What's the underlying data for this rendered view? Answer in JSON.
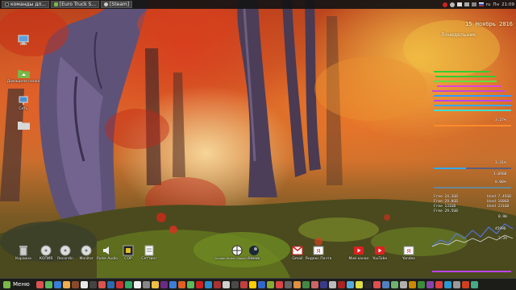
{
  "top_panel": {
    "tasks": [
      {
        "label": "команды дл...",
        "icon": "terminal-icon",
        "color": "#444444"
      },
      {
        "label": "[Euro Truck S...",
        "icon": "folder-icon",
        "color": "#7ab648"
      },
      {
        "label": "[Steam]",
        "icon": "steam-icon",
        "color": "#cccccc"
      }
    ],
    "tray_time": "21:09",
    "tray_day": "Пн",
    "tray_layout": "ru"
  },
  "desktop_icons": [
    {
      "name": "computer",
      "label": "",
      "icon": "monitor-icon"
    },
    {
      "name": "home",
      "label": "Домашняя папка",
      "icon": "folder-home-icon"
    },
    {
      "name": "network",
      "label": "Сеть",
      "icon": "network-icon"
    },
    {
      "name": "trash-left",
      "label": "",
      "icon": "folder-icon"
    }
  ],
  "dock_icons": [
    {
      "label": "Корзина",
      "icon": "trash-icon"
    },
    {
      "label": "КОПИЯ",
      "icon": "disk-icon"
    },
    {
      "label": "Recordin",
      "icon": "disk-icon"
    },
    {
      "label": "Monitor",
      "icon": "disk-icon"
    },
    {
      "label": "Pulse Audio",
      "icon": "sound-icon"
    },
    {
      "label": "СОР",
      "icon": "app-icon"
    },
    {
      "label": "Сеттинг",
      "icon": "doc-icon"
    },
    {
      "label": "Counter-Strike: Global Offensive",
      "icon": "csgo-icon"
    },
    {
      "label": "Steam",
      "icon": "steam-icon"
    },
    {
      "label": "Gmail",
      "icon": "gmail-icon"
    },
    {
      "label": "Яндекс.Почта",
      "icon": "yandex-mail-icon"
    },
    {
      "label": "Мой канал",
      "icon": "youtube-icon"
    },
    {
      "label": "YouTube",
      "icon": "youtube-icon"
    },
    {
      "label": "Yandex",
      "icon": "yandex-icon"
    }
  ],
  "conky": {
    "date": "15 Ноябрь 2016",
    "day": "Понедельник",
    "cpu_percent": "3.27%",
    "cpu2": "3.31%",
    "ram": "1.09GB",
    "swap": "0.00%",
    "disk_rows": [
      {
        "free": "Free 24.3GB",
        "used": "Used 7.45GB"
      },
      {
        "free": "Free 29.0GB",
        "used": "Used 160GB"
      },
      {
        "free": "Free 131GB",
        "used": "Used 231GB"
      },
      {
        "free": "Free 29.5GB",
        "used": ""
      }
    ],
    "net_up": "2.39",
    "net_down": "8.90",
    "uptime": "45996"
  },
  "bottom_panel": {
    "menu_label": "Меню",
    "launcher_colors": [
      "#d9534f",
      "#5cb85c",
      "#3b7dd8",
      "#f0ad4e",
      "#8a4a2a",
      "#e8e8e8",
      "#444444",
      "#d9534f",
      "#2a6ab0",
      "#cc3333",
      "#33aa66",
      "#eeeeee",
      "#888888",
      "#f0c040",
      "#6a2a8a",
      "#3b7dd8",
      "#e06020",
      "#5cb85c",
      "#cc2222",
      "#2a8acc",
      "#aa3333",
      "#d0d0d0",
      "#4a4a4a",
      "#c04040",
      "#ffcc00",
      "#3366cc",
      "#88aa33",
      "#dd4444",
      "#666666",
      "#e09040",
      "#448844",
      "#cc6666",
      "#3a3a8a",
      "#bbbbbb",
      "#aa2222",
      "#55aadd",
      "#dddd44",
      "#2a2a2a",
      "#e05050",
      "#5080c0",
      "#70b070",
      "#b0b0b0",
      "#cc8800",
      "#3c8c3c",
      "#8844aa",
      "#e04040",
      "#2a9ad0",
      "#999999",
      "#d04020",
      "#44aa88"
    ]
  }
}
